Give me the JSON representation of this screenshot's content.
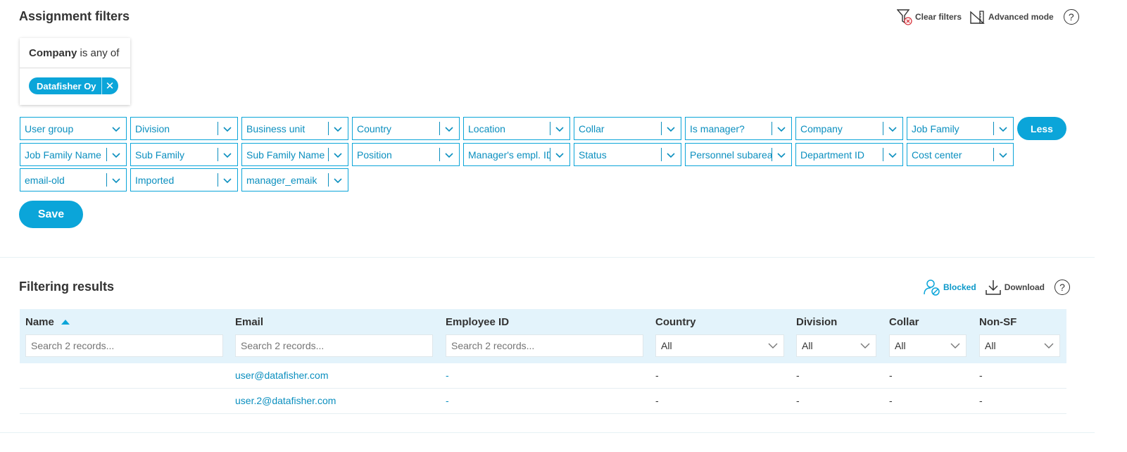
{
  "assignment": {
    "title": "Assignment filters",
    "toolbar": {
      "clear_filters": "Clear filters",
      "advanced_mode": "Advanced mode",
      "help": "?"
    },
    "company_filter": {
      "field": "Company",
      "operator": "is any of",
      "chip": "Datafisher Oy",
      "chip_remove": "✕"
    },
    "dropdowns": [
      "User group",
      "Division",
      "Business unit",
      "Country",
      "Location",
      "Collar",
      "Is manager?",
      "Company",
      "Job Family",
      "Job Family Name",
      "Sub Family",
      "Sub Family Name",
      "Position",
      "Manager's empl. ID",
      "Status",
      "Personnel subarea",
      "Department ID",
      "Cost center",
      "email-old",
      "Imported",
      "manager_emaik"
    ],
    "less_label": "Less",
    "save_label": "Save"
  },
  "results": {
    "title": "Filtering results",
    "toolbar": {
      "blocked": "Blocked",
      "download": "Download",
      "help": "?"
    },
    "columns": [
      "Name",
      "Email",
      "Employee ID",
      "Country",
      "Division",
      "Collar",
      "Non-SF"
    ],
    "search_placeholder": "Search 2 records...",
    "select_value": "All",
    "rows": [
      [
        "",
        "user@datafisher.com",
        "-",
        "-",
        "-",
        "-",
        "-"
      ],
      [
        "",
        "user.2@datafisher.com",
        "-",
        "-",
        "-",
        "-",
        "-"
      ]
    ]
  },
  "colors": {
    "accent": "#0ba5d9",
    "header_bg": "#e3f3fb"
  }
}
